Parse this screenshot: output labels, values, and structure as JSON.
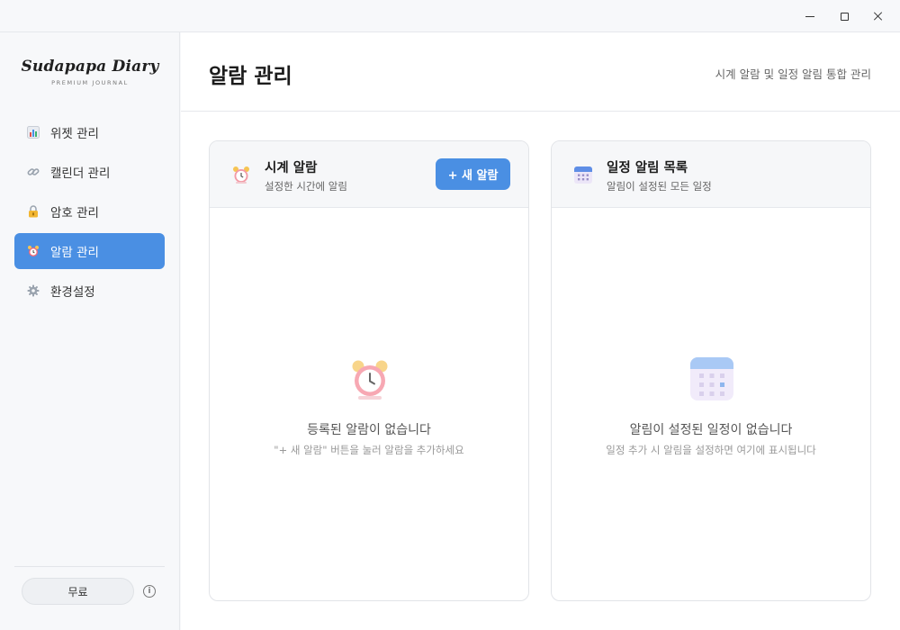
{
  "window": {
    "minimize_glyph": "—",
    "maximize_glyph": "☐",
    "close_glyph": "✕"
  },
  "sidebar": {
    "brand_title": "Sudapapa Diary",
    "brand_subtitle": "PREMIUM JOURNAL",
    "items": [
      {
        "label": "위젯 관리",
        "icon": "bar-chart-icon"
      },
      {
        "label": "캘린더 관리",
        "icon": "link-icon"
      },
      {
        "label": "암호 관리",
        "icon": "lock-icon"
      },
      {
        "label": "알람 관리",
        "icon": "alarm-clock-icon",
        "active": true
      },
      {
        "label": "환경설정",
        "icon": "gear-icon"
      }
    ],
    "plan_label": "무료",
    "info_glyph": "i"
  },
  "header": {
    "title": "알람 관리",
    "subtitle": "시계 알람 및 일정 알림 통합 관리"
  },
  "clock_alarm_card": {
    "title": "시계 알람",
    "subtitle": "설정한 시간에 알림",
    "add_button": "+ 새 알람",
    "empty_title": "등록된 알람이 없습니다",
    "empty_subtitle": "\"+ 새 알람\" 버튼을 눌러 알람을 추가하세요"
  },
  "schedule_card": {
    "title": "일정 알림 목록",
    "subtitle": "알림이 설정된 모든 일정",
    "empty_title": "알림이 설정된 일정이 없습니다",
    "empty_subtitle": "일정 추가 시 알림을 설정하면 여기에 표시됩니다"
  },
  "colors": {
    "accent": "#4a8fe3",
    "sidebar_bg": "#f7f8fa",
    "card_head_bg": "#f6f7f9"
  }
}
